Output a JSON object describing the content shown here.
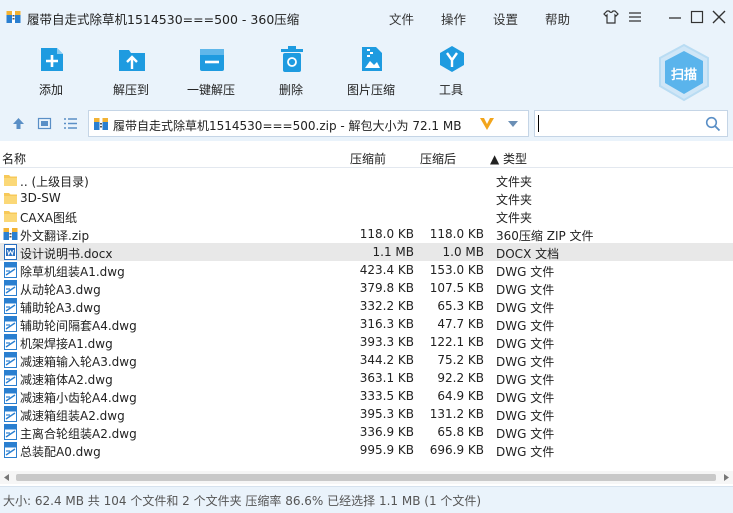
{
  "title": "履带自走式除草机1514530===500 - 360压缩",
  "menu": [
    "文件",
    "操作",
    "设置",
    "帮助"
  ],
  "toolbar": {
    "add": "添加",
    "extract_to": "解压到",
    "one_click_extract": "一键解压",
    "delete": "删除",
    "image_compress": "图片压缩",
    "tools": "工具",
    "scan": "扫描"
  },
  "address": {
    "path": "履带自走式除草机1514530===500.zip - 解包大小为 72.1 MB",
    "search_value": ""
  },
  "columns": {
    "name": "名称",
    "original_size": "压缩前",
    "compressed_size": "压缩后",
    "type": "▲ 类型"
  },
  "files": [
    {
      "name": ".. (上级目录)",
      "size": "",
      "packed": "",
      "type": "文件夹",
      "icon": "folder-icon"
    },
    {
      "name": "3D-SW",
      "size": "",
      "packed": "",
      "type": "文件夹",
      "icon": "folder-icon"
    },
    {
      "name": "CAXA图纸",
      "size": "",
      "packed": "",
      "type": "文件夹",
      "icon": "folder-icon"
    },
    {
      "name": "外文翻译.zip",
      "size": "118.0 KB",
      "packed": "118.0 KB",
      "type": "360压缩 ZIP 文件",
      "icon": "zip-icon"
    },
    {
      "name": "设计说明书.docx",
      "size": "1.1 MB",
      "packed": "1.0 MB",
      "type": "DOCX 文档",
      "icon": "docx-icon"
    },
    {
      "name": "除草机组装A1.dwg",
      "size": "423.4 KB",
      "packed": "153.0 KB",
      "type": "DWG 文件",
      "icon": "dwg-icon"
    },
    {
      "name": "从动轮A3.dwg",
      "size": "379.8 KB",
      "packed": "107.5 KB",
      "type": "DWG 文件",
      "icon": "dwg-icon"
    },
    {
      "name": "辅助轮A3.dwg",
      "size": "332.2 KB",
      "packed": "65.3 KB",
      "type": "DWG 文件",
      "icon": "dwg-icon"
    },
    {
      "name": "辅助轮间隔套A4.dwg",
      "size": "316.3 KB",
      "packed": "47.7 KB",
      "type": "DWG 文件",
      "icon": "dwg-icon"
    },
    {
      "name": "机架焊接A1.dwg",
      "size": "393.3 KB",
      "packed": "122.1 KB",
      "type": "DWG 文件",
      "icon": "dwg-icon"
    },
    {
      "name": "减速箱输入轮A3.dwg",
      "size": "344.2 KB",
      "packed": "75.2 KB",
      "type": "DWG 文件",
      "icon": "dwg-icon"
    },
    {
      "name": "减速箱体A2.dwg",
      "size": "363.1 KB",
      "packed": "92.2 KB",
      "type": "DWG 文件",
      "icon": "dwg-icon"
    },
    {
      "name": "减速箱小齿轮A4.dwg",
      "size": "333.5 KB",
      "packed": "64.9 KB",
      "type": "DWG 文件",
      "icon": "dwg-icon"
    },
    {
      "name": "减速箱组装A2.dwg",
      "size": "395.3 KB",
      "packed": "131.2 KB",
      "type": "DWG 文件",
      "icon": "dwg-icon"
    },
    {
      "name": "主离合轮组装A2.dwg",
      "size": "336.9 KB",
      "packed": "65.8 KB",
      "type": "DWG 文件",
      "icon": "dwg-icon"
    },
    {
      "name": "总装配A0.dwg",
      "size": "995.9 KB",
      "packed": "696.9 KB",
      "type": "DWG 文件",
      "icon": "dwg-icon"
    }
  ],
  "selected_index": 4,
  "status": "大小: 62.4 MB 共 104 个文件和 2 个文件夹 压缩率 86.6% 已经选择 1.1 MB (1 个文件)",
  "colors": {
    "chrome": "#eaf3fb",
    "accent": "#1e9be0",
    "folder": "#f7c959",
    "dwg": "#2a7fd0",
    "selected_row": "#e8e8e8"
  }
}
